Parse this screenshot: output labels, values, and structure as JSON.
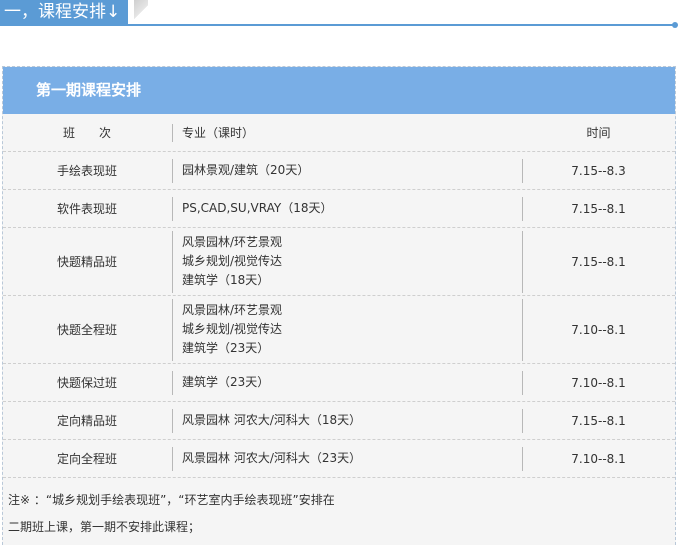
{
  "section": {
    "title": "一，课程安排↓",
    "accent": "#5b9bd5"
  },
  "card": {
    "title": "第一期课程安排",
    "title_bg": "#79aee6"
  },
  "table": {
    "headers": [
      "班　　次",
      "专业（课时）",
      "时间"
    ],
    "rows": [
      {
        "cls": "手绘表现班",
        "major": [
          "园林景观/建筑（20天）"
        ],
        "time": "7.15--8.3"
      },
      {
        "cls": "软件表现班",
        "major": [
          "PS,CAD,SU,VRAY（18天）"
        ],
        "time": "7.15--8.1"
      },
      {
        "cls": "快题精品班",
        "major": [
          "风景园林/环艺景观",
          "城乡规划/视觉传达",
          "建筑学（18天）"
        ],
        "time": "7.15--8.1"
      },
      {
        "cls": "快题全程班",
        "major": [
          "风景园林/环艺景观",
          "城乡规划/视觉传达",
          "建筑学（23天）"
        ],
        "time": "7.10--8.1"
      },
      {
        "cls": "快题保过班",
        "major": [
          "建筑学（23天）"
        ],
        "time": "7.10--8.1"
      },
      {
        "cls": "定向精品班",
        "major": [
          "风景园林 河农大/河科大（18天）"
        ],
        "time": "7.15--8.1"
      },
      {
        "cls": "定向全程班",
        "major": [
          "风景园林 河农大/河科大（23天）"
        ],
        "time": "7.10--8.1"
      }
    ]
  },
  "note": {
    "line1": "注※ ：“城乡规划手绘表现班”，“环艺室内手绘表现班”安排在",
    "line2": "二期班上课，第一期不安排此课程；"
  }
}
